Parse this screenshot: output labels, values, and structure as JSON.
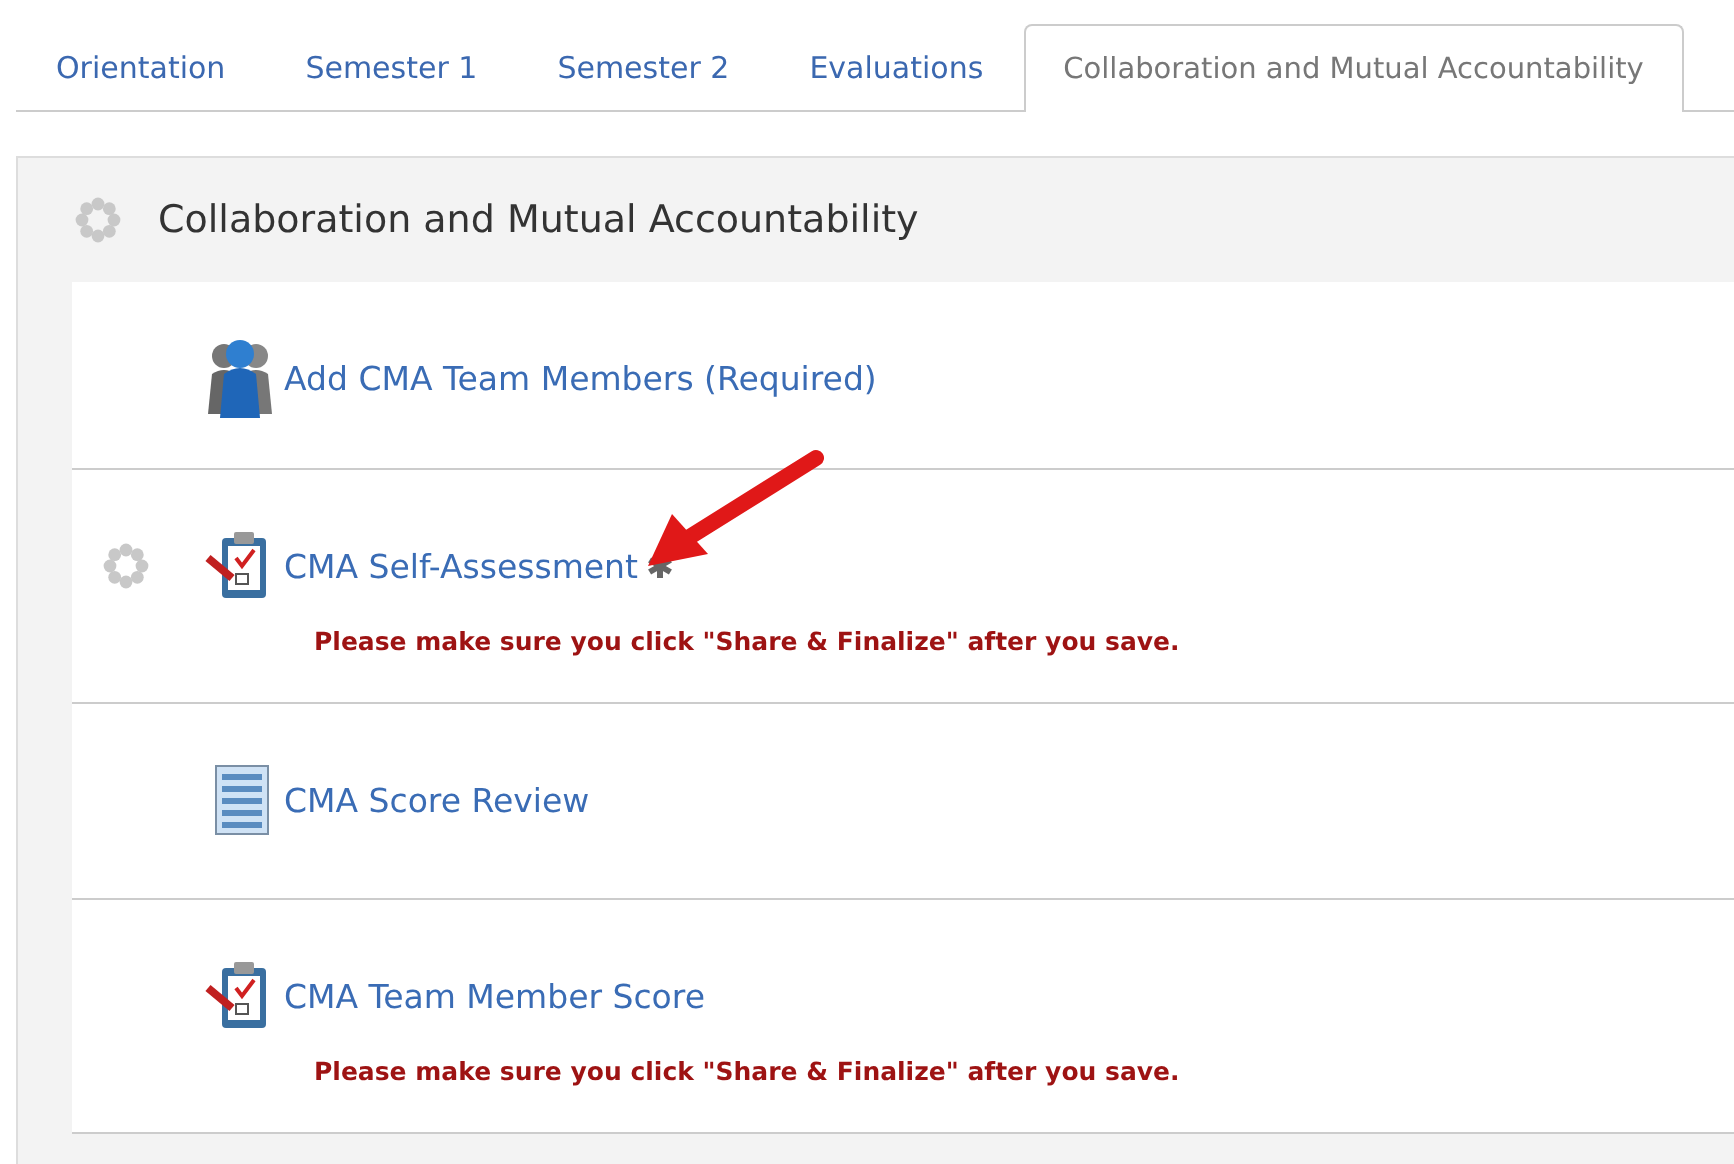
{
  "tabs": [
    {
      "label": "Orientation",
      "selected": false
    },
    {
      "label": "Semester 1",
      "selected": false
    },
    {
      "label": "Semester 2",
      "selected": false
    },
    {
      "label": "Evaluations",
      "selected": false
    },
    {
      "label": "Collaboration and Mutual Accountability",
      "selected": true
    }
  ],
  "panel": {
    "title": "Collaboration and Mutual Accountability",
    "busy": true,
    "items": [
      {
        "kind": "people",
        "label": "Add CMA Team Members (Required)",
        "busy": false,
        "marked": false,
        "pointer_arrow": false
      },
      {
        "kind": "clipboard",
        "label": "CMA Self-Assessment",
        "busy": true,
        "marked": true,
        "pointer_arrow": true,
        "note": "Please make sure you click \"Share & Finalize\" after you save."
      },
      {
        "kind": "form",
        "label": "CMA Score Review",
        "busy": false,
        "marked": false,
        "pointer_arrow": false
      },
      {
        "kind": "clipboard",
        "label": "CMA Team Member Score",
        "busy": false,
        "marked": false,
        "pointer_arrow": false,
        "note": "Please make sure you click \"Share & Finalize\" after you save."
      }
    ]
  }
}
